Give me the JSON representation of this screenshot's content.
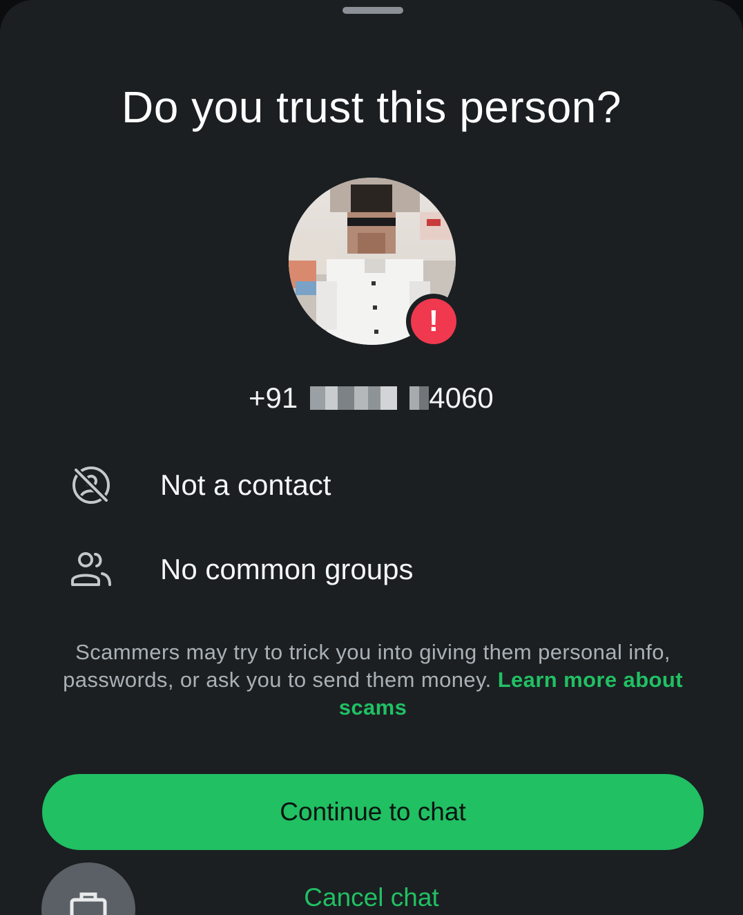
{
  "sheet": {
    "title": "Do you trust this person?",
    "phone": {
      "prefix": "+91",
      "suffix": "4060"
    },
    "info": [
      {
        "icon": "not-a-contact-icon",
        "label": "Not a contact"
      },
      {
        "icon": "groups-icon",
        "label": "No common groups"
      }
    ],
    "notice": {
      "text": "Scammers may try to trick you into giving them personal info, passwords, or ask you to send them money.",
      "link": "Learn more about scams"
    },
    "buttons": {
      "continue_label": "Continue to chat",
      "cancel_label": "Cancel chat"
    }
  },
  "colors": {
    "background": "#1b1f22",
    "accent": "#21c063",
    "alert": "#f0394e",
    "text_primary": "#ffffff",
    "text_secondary": "#aab1b6"
  }
}
